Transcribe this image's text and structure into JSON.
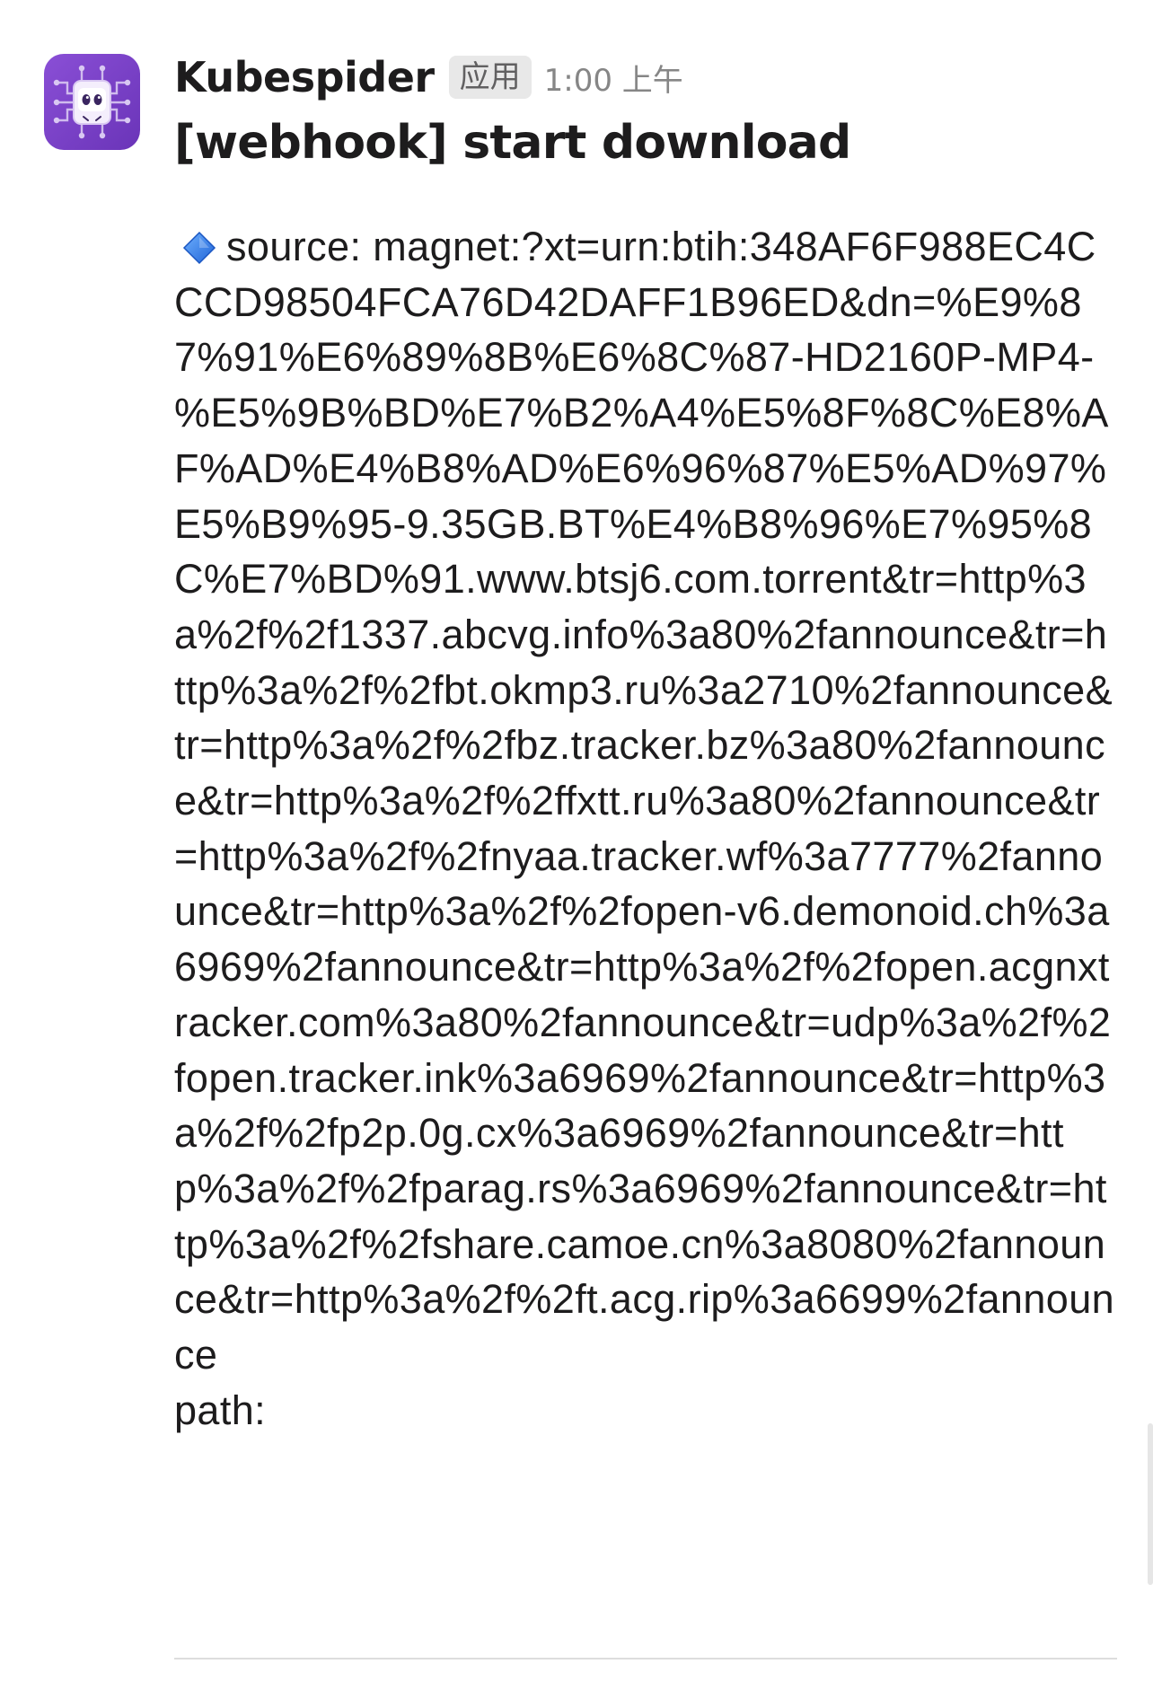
{
  "message": {
    "sender": "Kubespider",
    "app_badge": "应用",
    "timestamp": "1:00 上午",
    "title": "[webhook] start download",
    "source_label": "source: ",
    "source_value": "magnet:?xt=urn:btih:348AF6F988EC4CCCD98504FCA76D42DAFF1B96ED&dn=%E9%87%91%E6%89%8B%E6%8C%87-HD2160P-MP4-%E5%9B%BD%E7%B2%A4%E5%8F%8C%E8%AF%AD%E4%B8%AD%E6%96%87%E5%AD%97%E5%B9%95-9.35GB.BT%E4%B8%96%E7%95%8C%E7%BD%91.www.btsj6.com.torrent&tr=http%3a%2f%2f1337.abcvg.info%3a80%2fannounce&tr=http%3a%2f%2fbt.okmp3.ru%3a2710%2fannounce&tr=http%3a%2f%2fbz.tracker.bz%3a80%2fannounce&tr=http%3a%2f%2ffxtt.ru%3a80%2fannounce&tr=http%3a%2f%2fnyaa.tracker.wf%3a7777%2fannounce&tr=http%3a%2f%2fopen-v6.demonoid.ch%3a6969%2fannounce&tr=http%3a%2f%2fopen.acgnxtracker.com%3a80%2fannounce&tr=udp%3a%2f%2fopen.tracker.ink%3a6969%2fannounce&tr=http%3a%2f%2fp2p.0g.cx%3a6969%2fannounce&tr=http%3a%2f%2fparag.rs%3a6969%2fannounce&tr=http%3a%2f%2fshare.camoe.cn%3a8080%2fannounce&tr=http%3a%2f%2ft.acg.rip%3a6699%2fannounce",
    "path_label": "path:",
    "bullet_icon": "small-blue-diamond-icon"
  },
  "colors": {
    "avatar_bg": "#7b45c9",
    "diamond": "#3b82f6",
    "text": "#1d1c1d",
    "muted": "#868686"
  }
}
